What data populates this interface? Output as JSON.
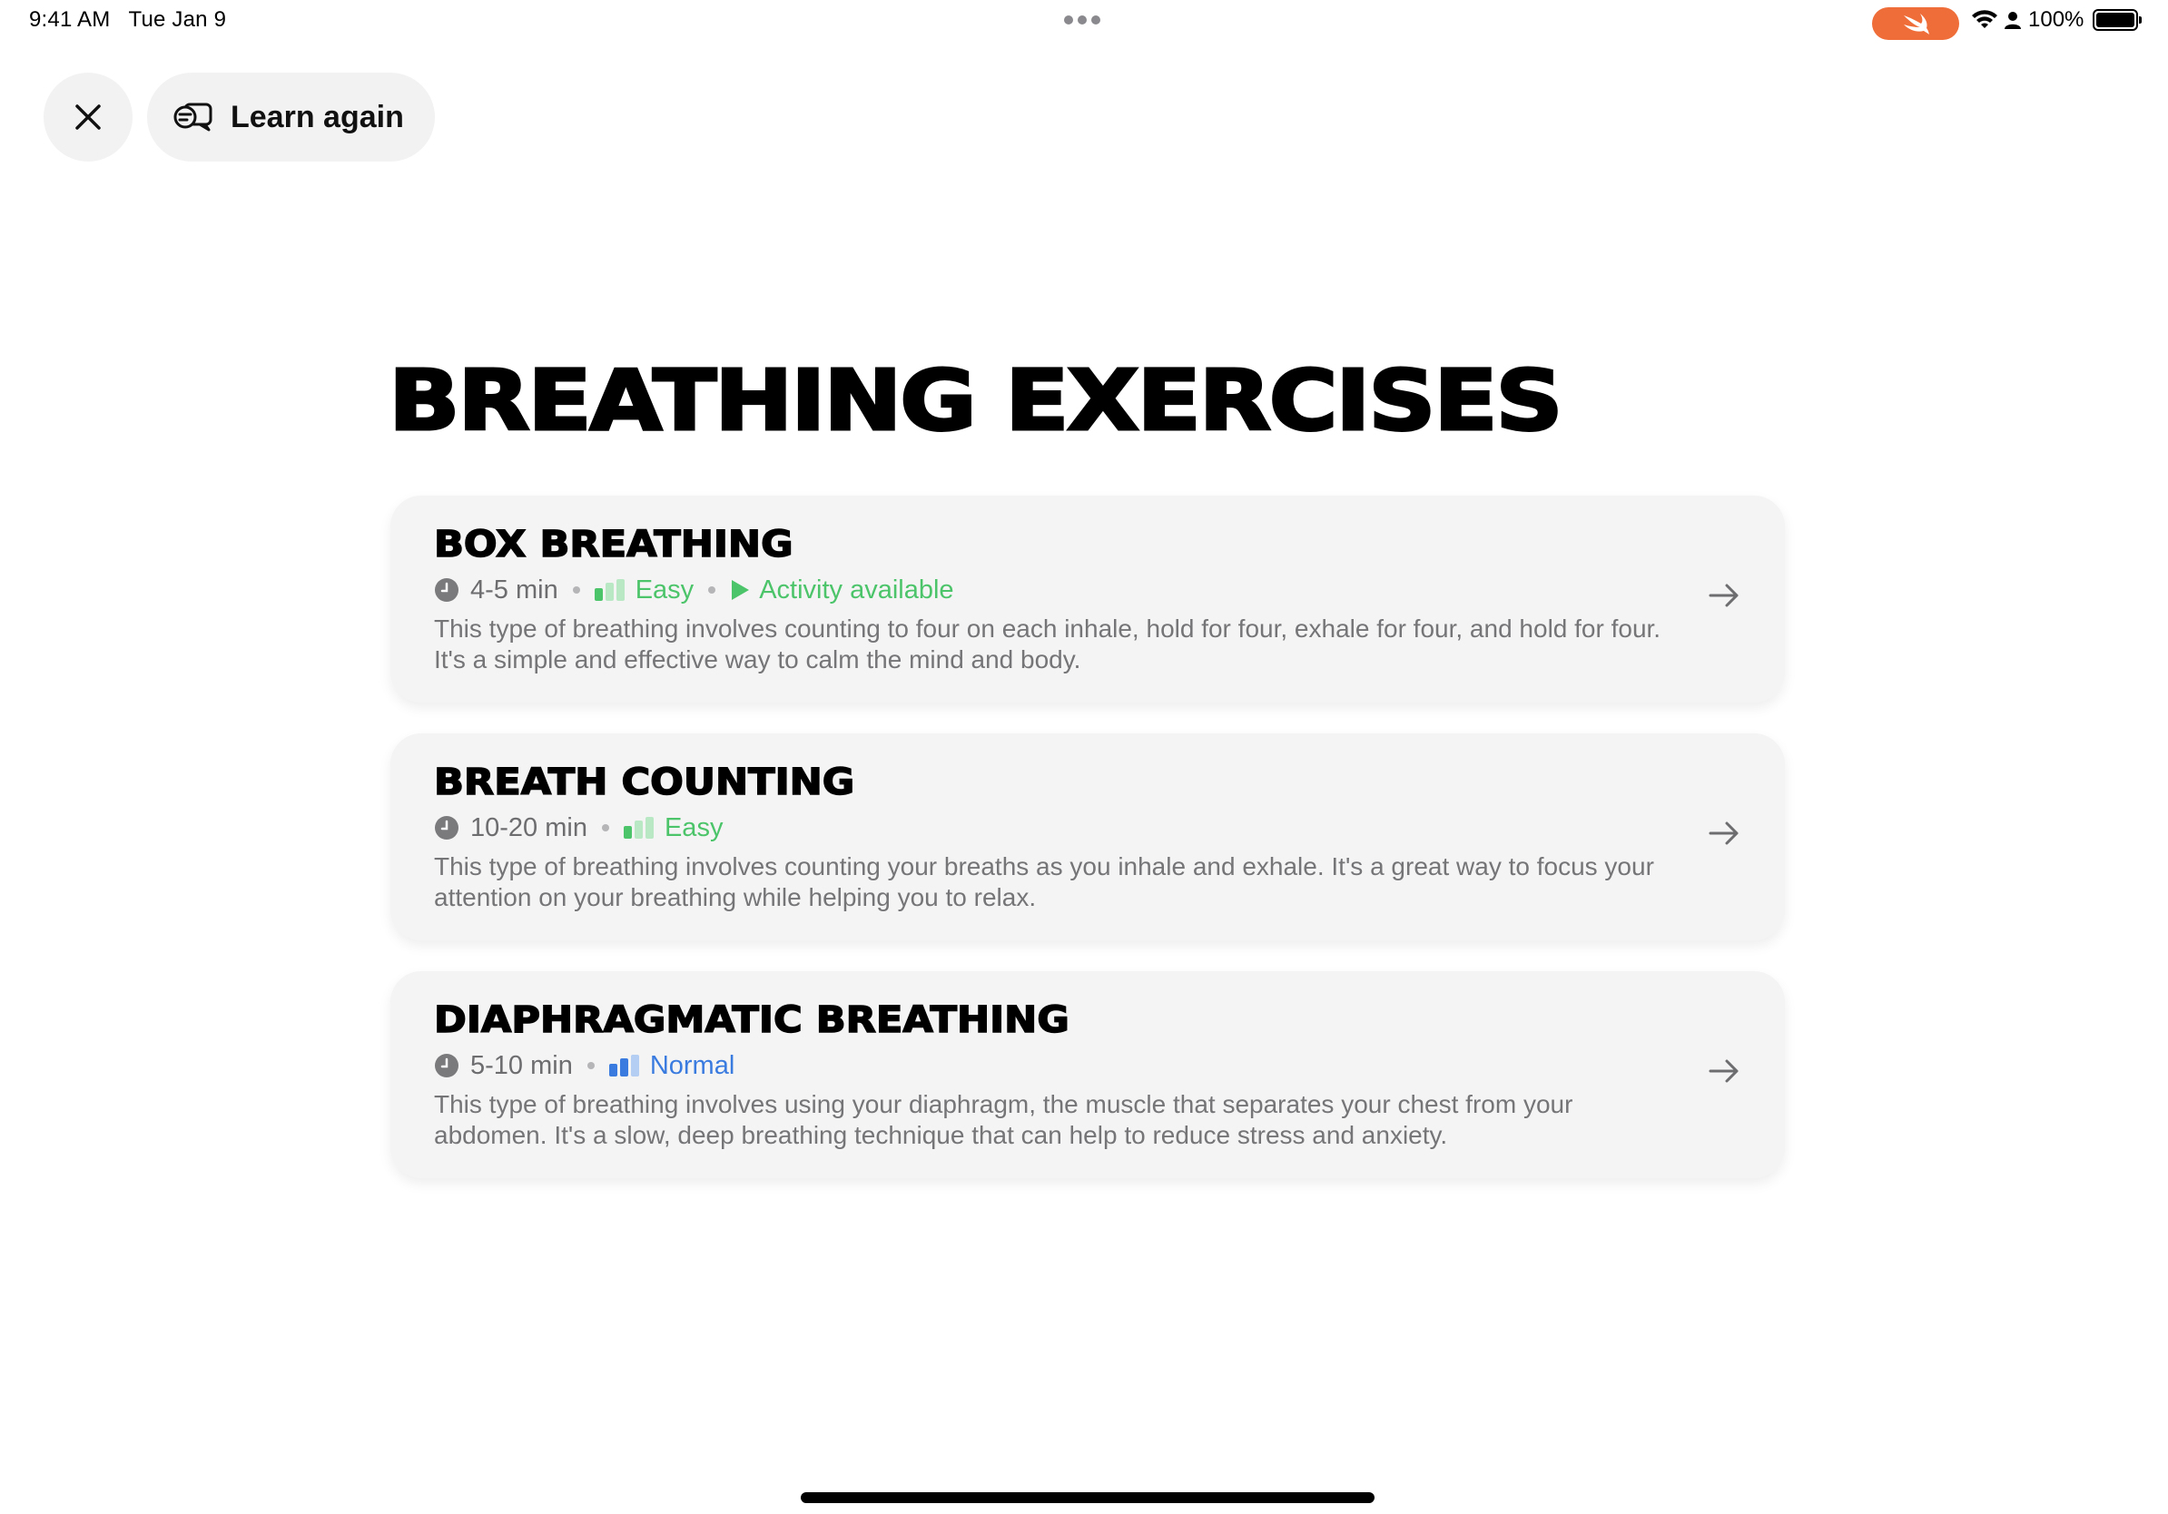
{
  "status_bar": {
    "time": "9:41 AM",
    "date": "Tue Jan 9",
    "battery": "100%"
  },
  "toolbar": {
    "learn_again_label": "Learn again"
  },
  "page": {
    "title": "BREATHING EXERCISES"
  },
  "exercises": [
    {
      "title": "BOX BREATHING",
      "duration": "4-5 min",
      "difficulty": "Easy",
      "activity": "Activity available",
      "description": "This type of breathing involves counting to four on each inhale, hold for four, exhale for four, and hold for four. It's a simple and effective way to calm the mind and body."
    },
    {
      "title": "BREATH COUNTING",
      "duration": "10-20 min",
      "difficulty": "Easy",
      "description": "This type of breathing involves counting your breaths as you inhale and exhale. It's a great way to focus your attention on your breathing while helping you to relax."
    },
    {
      "title": "DIAPHRAGMATIC BREATHING",
      "duration": "5-10 min",
      "difficulty": "Normal",
      "description": "This type of breathing involves using your diaphragm, the muscle that separates your chest from your abdomen. It's a slow, deep breathing technique that can help to reduce stress and anxiety."
    }
  ],
  "colors": {
    "easy": "#4cc46a",
    "normal": "#3a7be0",
    "swift_accent": "#ef6d38",
    "card_bg": "#f4f4f4"
  },
  "icons": [
    "clock-icon",
    "difficulty-bars-icon",
    "play-icon",
    "arrow-right-icon",
    "close-icon",
    "learn-chat-icon",
    "wifi-icon",
    "person-icon",
    "battery-icon",
    "swift-icon"
  ]
}
